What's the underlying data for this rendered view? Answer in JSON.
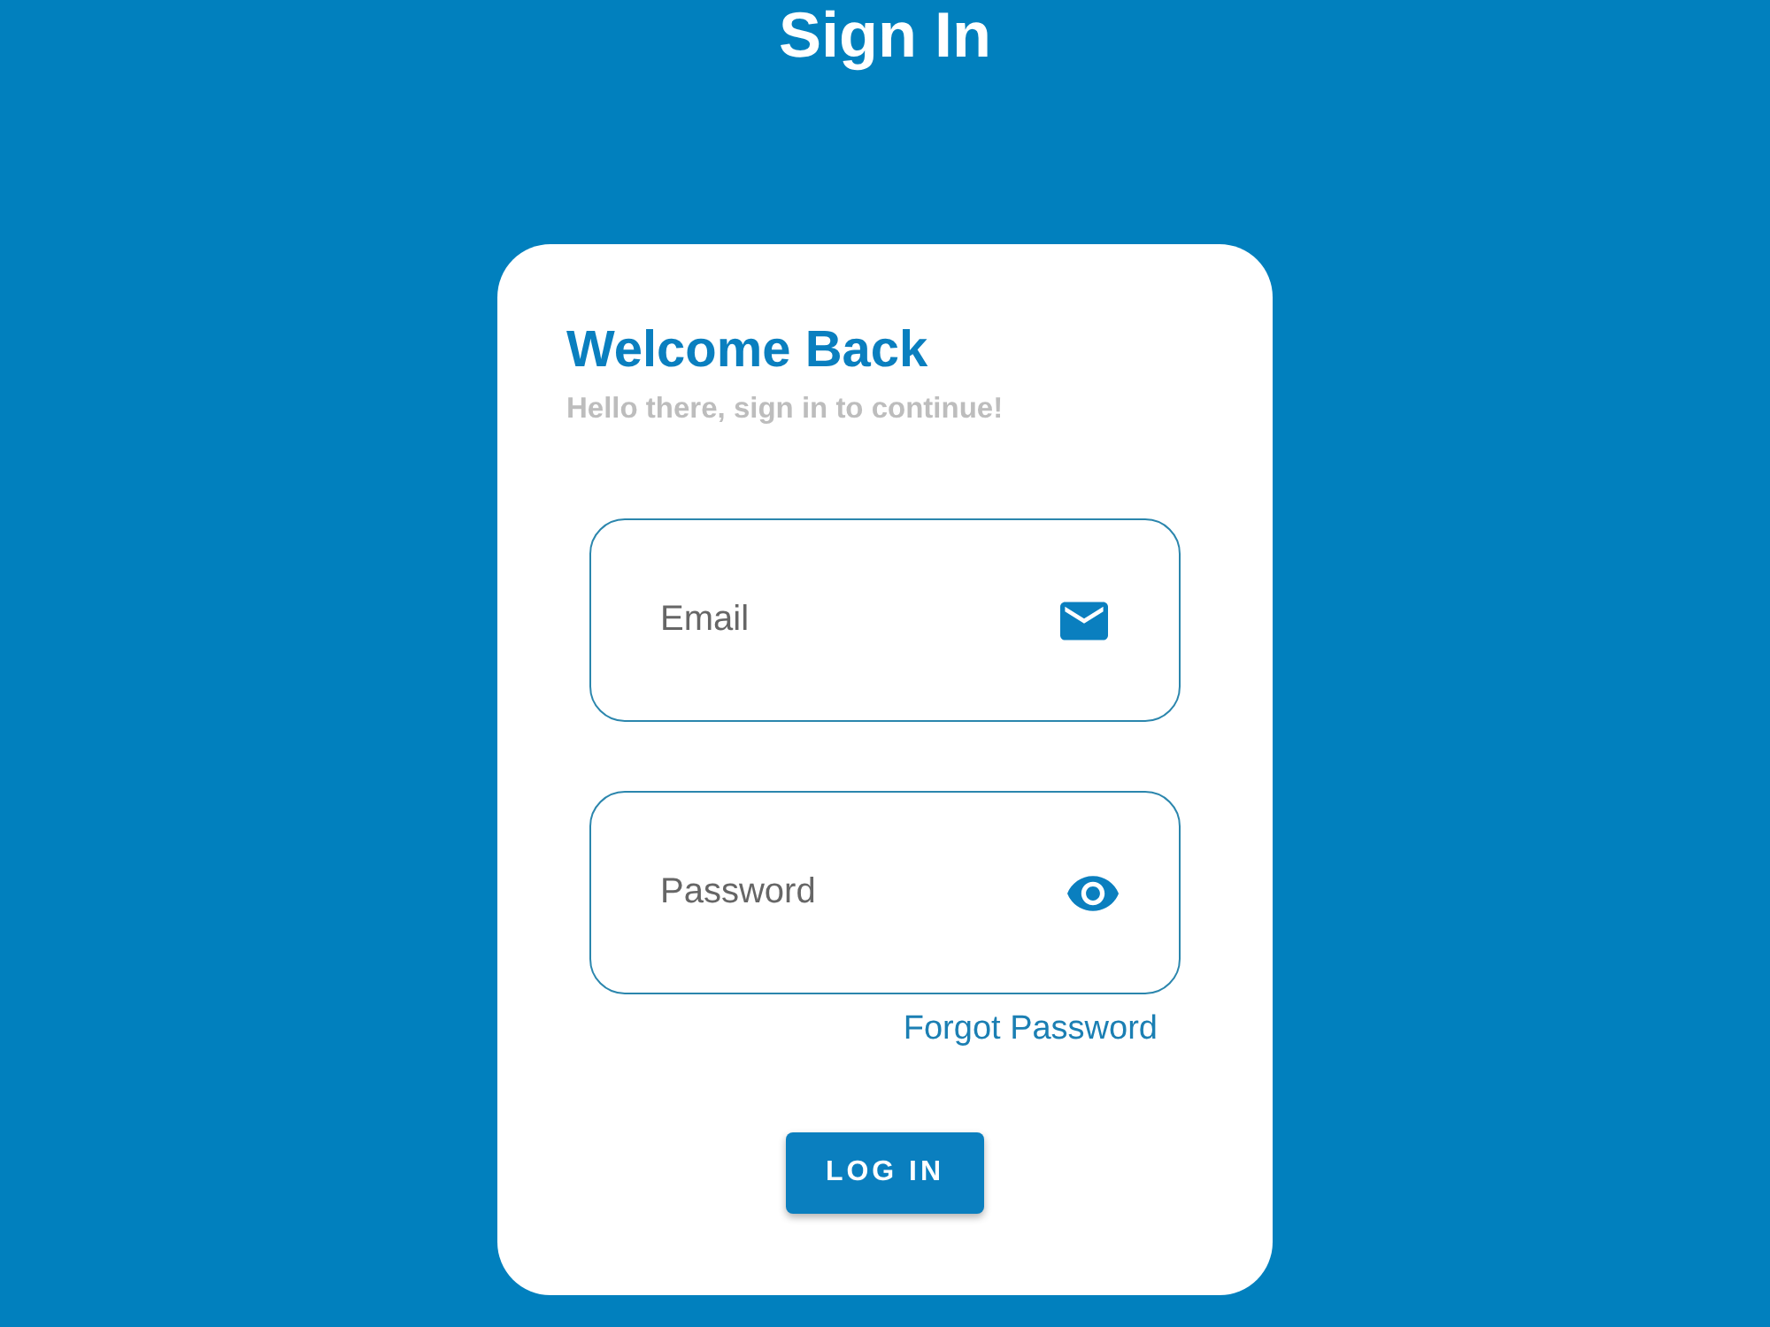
{
  "header": {
    "title": "Sign In"
  },
  "card": {
    "heading": "Welcome Back",
    "subtitle": "Hello there, sign in to continue!",
    "fields": [
      {
        "kind": "email",
        "placeholder": "Email"
      },
      {
        "kind": "password",
        "placeholder": "Password"
      }
    ],
    "forgot_link": "Forgot Password",
    "login_button": "LOG IN"
  }
}
